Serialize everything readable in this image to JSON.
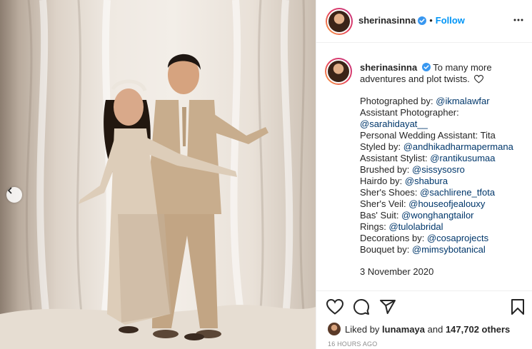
{
  "post": {
    "username": "sherinasinna",
    "follow_label": "Follow",
    "separator": "•"
  },
  "caption": {
    "text": "To many more adventures and plot twists.",
    "credits": [
      {
        "label": "Photographed by: ",
        "mention": "@ikmalawfar"
      },
      {
        "label": "Assistant Photographer:",
        "mention": ""
      },
      {
        "label": "",
        "mention": "@sarahidayat__"
      },
      {
        "label": "Personal Wedding Assistant: Tita",
        "mention": ""
      },
      {
        "label": "Styled by: ",
        "mention": "@andhikadharmapermana"
      },
      {
        "label": "Assistant Stylist: ",
        "mention": "@rantikusumaa"
      },
      {
        "label": "Brushed by: ",
        "mention": "@sissysosro"
      },
      {
        "label": "Hairdo by: ",
        "mention": "@shabura"
      },
      {
        "label": "Sher's Shoes: ",
        "mention": "@sachlirene_tfota"
      },
      {
        "label": "Sher's Veil: ",
        "mention": "@houseofjealouxy"
      },
      {
        "label": "Bas' Suit: ",
        "mention": "@wonghangtailor"
      },
      {
        "label": "Rings: ",
        "mention": "@tulolabridal"
      },
      {
        "label": "Decorations by: ",
        "mention": "@cosaprojects"
      },
      {
        "label": "Bouquet by: ",
        "mention": "@mimsybotanical"
      }
    ],
    "date": "3 November 2020"
  },
  "likes": {
    "prefix": "Liked by ",
    "user": "lunamaya",
    "middle": " and ",
    "count": "147,702 others"
  },
  "timestamp": "16 HOURS AGO",
  "icons": {
    "verified": "verified-badge-icon",
    "more": "more-options-icon",
    "like": "heart-icon",
    "comment": "comment-icon",
    "share": "paper-plane-icon",
    "save": "bookmark-icon",
    "prev": "chevron-left-icon"
  },
  "colors": {
    "accent": "#0095f6",
    "mention": "#00376b",
    "text": "#262626",
    "muted": "#8e8e8e",
    "border": "#efefef"
  }
}
